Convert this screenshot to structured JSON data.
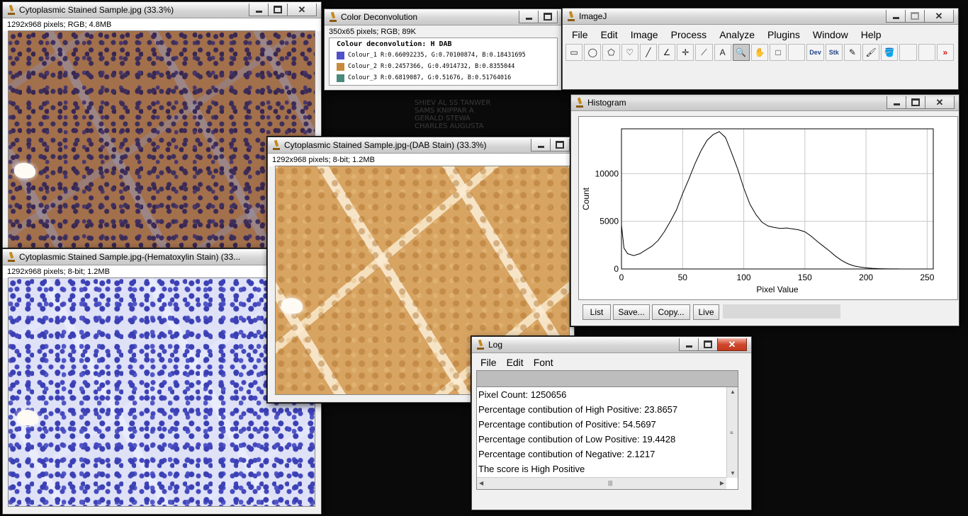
{
  "background_text": [
    "SHIEV AL SS TANWER",
    "SAMS KNIPPAR A",
    "GERALD STEWA",
    "CHARLES AUGUSTA"
  ],
  "rgb_window": {
    "title": "Cytoplasmic Stained Sample.jpg (33.3%)",
    "info": "1292x968 pixels; RGB; 4.8MB"
  },
  "hema_window": {
    "title": "Cytoplasmic Stained Sample.jpg-(Hematoxylin Stain) (33...",
    "info": "1292x968 pixels; 8-bit; 1.2MB"
  },
  "dab_window": {
    "title": "Cytoplasmic Stained Sample.jpg-(DAB Stain) (33.3%)",
    "info": "1292x968 pixels; 8-bit; 1.2MB"
  },
  "colour_window": {
    "title": "Color Deconvolution",
    "info": "350x65 pixels; RGB; 89K",
    "heading": "Colour deconvolution: H DAB",
    "rows": [
      {
        "label": "Colour_1 R:0.66092235, G:0.70100874, B:0.18431695",
        "color": "#5050c8"
      },
      {
        "label": "Colour_2 R:0.2457366, G:0.4914732, B:0.8355044",
        "color": "#c88a3a"
      },
      {
        "label": "Colour_3 R:0.6819087, G:0.51676, B:0.51764016",
        "color": "#4a8a7e"
      }
    ]
  },
  "imagej": {
    "title": "ImageJ",
    "menus": [
      "File",
      "Edit",
      "Image",
      "Process",
      "Analyze",
      "Plugins",
      "Window",
      "Help"
    ],
    "tools": [
      {
        "name": "rectangle-tool-icon",
        "glyph": "▭"
      },
      {
        "name": "oval-tool-icon",
        "glyph": "◯"
      },
      {
        "name": "polygon-tool-icon",
        "glyph": "⬠"
      },
      {
        "name": "freehand-tool-icon",
        "glyph": "♡"
      },
      {
        "name": "line-tool-icon",
        "glyph": "╱"
      },
      {
        "name": "angle-tool-icon",
        "glyph": "∠"
      },
      {
        "name": "point-tool-icon",
        "glyph": "✛"
      },
      {
        "name": "wand-tool-icon",
        "glyph": "⟋"
      },
      {
        "name": "text-tool-icon",
        "glyph": "A"
      },
      {
        "name": "magnifier-tool-icon",
        "glyph": "🔍"
      },
      {
        "name": "hand-tool-icon",
        "glyph": "✋"
      },
      {
        "name": "color-picker-tool-icon",
        "glyph": "□"
      },
      {
        "name": "blank-tool-icon",
        "glyph": ""
      },
      {
        "name": "dev-menu-icon",
        "glyph": "Dev"
      },
      {
        "name": "stk-menu-icon",
        "glyph": "Stk"
      },
      {
        "name": "pencil-tool-icon",
        "glyph": "✎"
      },
      {
        "name": "brush-tool-icon",
        "glyph": "🖌"
      },
      {
        "name": "flood-fill-tool-icon",
        "glyph": "🪣"
      },
      {
        "name": "blank-tool-2-icon",
        "glyph": ""
      },
      {
        "name": "blank-tool-3-icon",
        "glyph": ""
      },
      {
        "name": "more-tools-icon",
        "glyph": "»"
      }
    ]
  },
  "histogram": {
    "title": "Histogram",
    "buttons": [
      "List",
      "Save...",
      "Copy...",
      "Live"
    ]
  },
  "chart_data": {
    "type": "line",
    "xlabel": "Pixel Value",
    "ylabel": "Count",
    "xlim": [
      0,
      255
    ],
    "ylim": [
      0,
      14700
    ],
    "xticks": [
      0,
      50,
      100,
      150,
      200,
      250
    ],
    "yticks": [
      0,
      5000,
      10000
    ],
    "x": [
      0,
      2,
      5,
      10,
      15,
      20,
      25,
      30,
      35,
      40,
      45,
      50,
      55,
      60,
      65,
      70,
      75,
      80,
      85,
      90,
      95,
      100,
      105,
      110,
      115,
      120,
      125,
      130,
      135,
      140,
      145,
      150,
      155,
      160,
      165,
      170,
      175,
      180,
      185,
      190,
      195,
      200,
      205,
      210,
      215,
      220,
      225,
      230
    ],
    "y": [
      4600,
      2200,
      1600,
      1400,
      1600,
      2000,
      2400,
      3000,
      3900,
      5000,
      6200,
      7900,
      9400,
      11000,
      12400,
      13500,
      14100,
      14400,
      13800,
      12200,
      10500,
      8500,
      6800,
      5700,
      4900,
      4500,
      4350,
      4250,
      4300,
      4200,
      4100,
      3900,
      3450,
      2900,
      2400,
      1900,
      1350,
      900,
      560,
      330,
      200,
      120,
      70,
      40,
      20,
      10,
      5,
      0
    ]
  },
  "log": {
    "title": "Log",
    "menus": [
      "File",
      "Edit",
      "Font"
    ],
    "lines": [
      "Pixel Count: 1250656",
      "Percentage contibution of High Positive:  23.8657",
      "Percentage contibution of Positive:  54.5697",
      "Percentage contibution of Low Positive:  19.4428",
      "Percentage contibution of Negative:  2.1217",
      "The score is High Positive"
    ]
  }
}
